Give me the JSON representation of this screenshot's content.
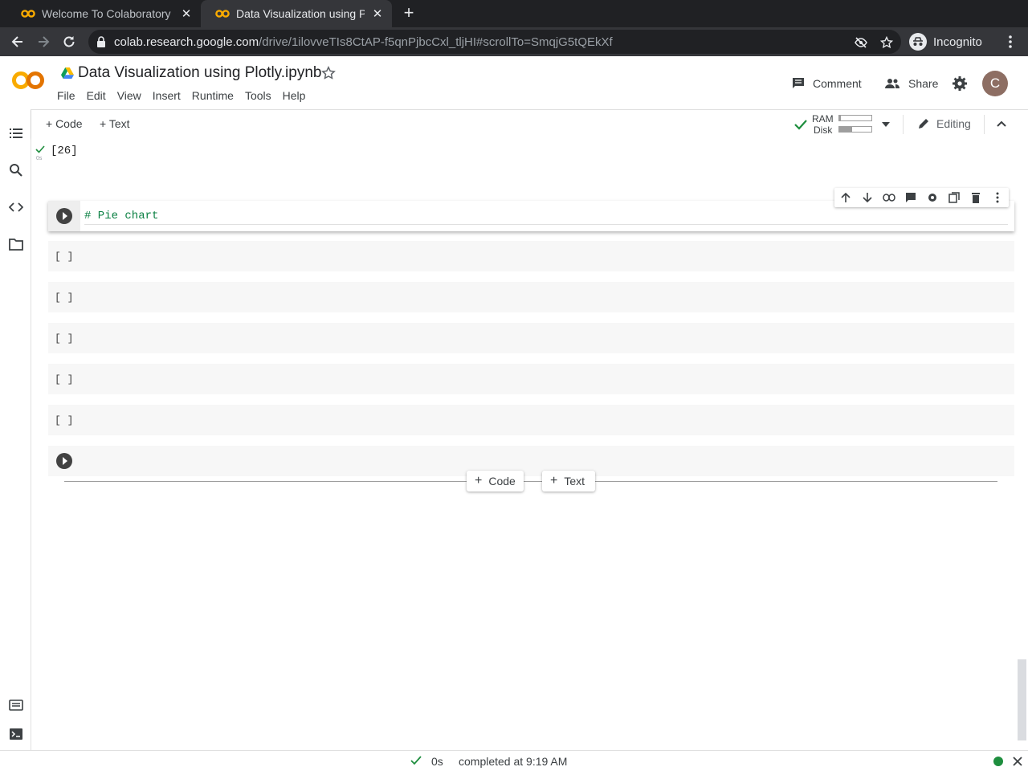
{
  "browser": {
    "tabs": [
      {
        "title": "Welcome To Colaboratory -",
        "active": false
      },
      {
        "title": "Data Visualization using Pl",
        "active": true
      }
    ],
    "new_tab_label": "+",
    "url_host": "colab.research.google.com",
    "url_path": "/drive/1ilovveTIs8CtAP-f5qnPjbcCxl_tljHI#scrollTo=SmqjG5tQEkXf",
    "profile_label": "Incognito"
  },
  "header": {
    "notebook_title": "Data Visualization using Plotly.ipynb",
    "menu": [
      "File",
      "Edit",
      "View",
      "Insert",
      "Runtime",
      "Tools",
      "Help"
    ],
    "comment_label": "Comment",
    "share_label": "Share",
    "avatar_letter": "C"
  },
  "toolbar": {
    "add_code_label": "+ Code",
    "add_text_label": "+ Text",
    "ram_label": "RAM",
    "disk_label": "Disk",
    "ram_usage": 0.05,
    "disk_usage": 0.4,
    "editing_label": "Editing"
  },
  "notebook": {
    "prev_output_count": "[26]",
    "prev_exec_time": "0s",
    "active_cell_code": "# Pie chart",
    "empty_prompts": [
      "[ ]",
      "[ ]",
      "[ ]",
      "[ ]",
      "[ ]"
    ],
    "insert_code_label": "Code",
    "insert_text_label": "Text"
  },
  "status": {
    "elapsed": "0s",
    "completed_text": "completed at 9:19 AM"
  },
  "colors": {
    "accent_green": "#1e8e3e",
    "logo_orange": "#f9ab00",
    "avatar_bg": "#8d6e63"
  }
}
